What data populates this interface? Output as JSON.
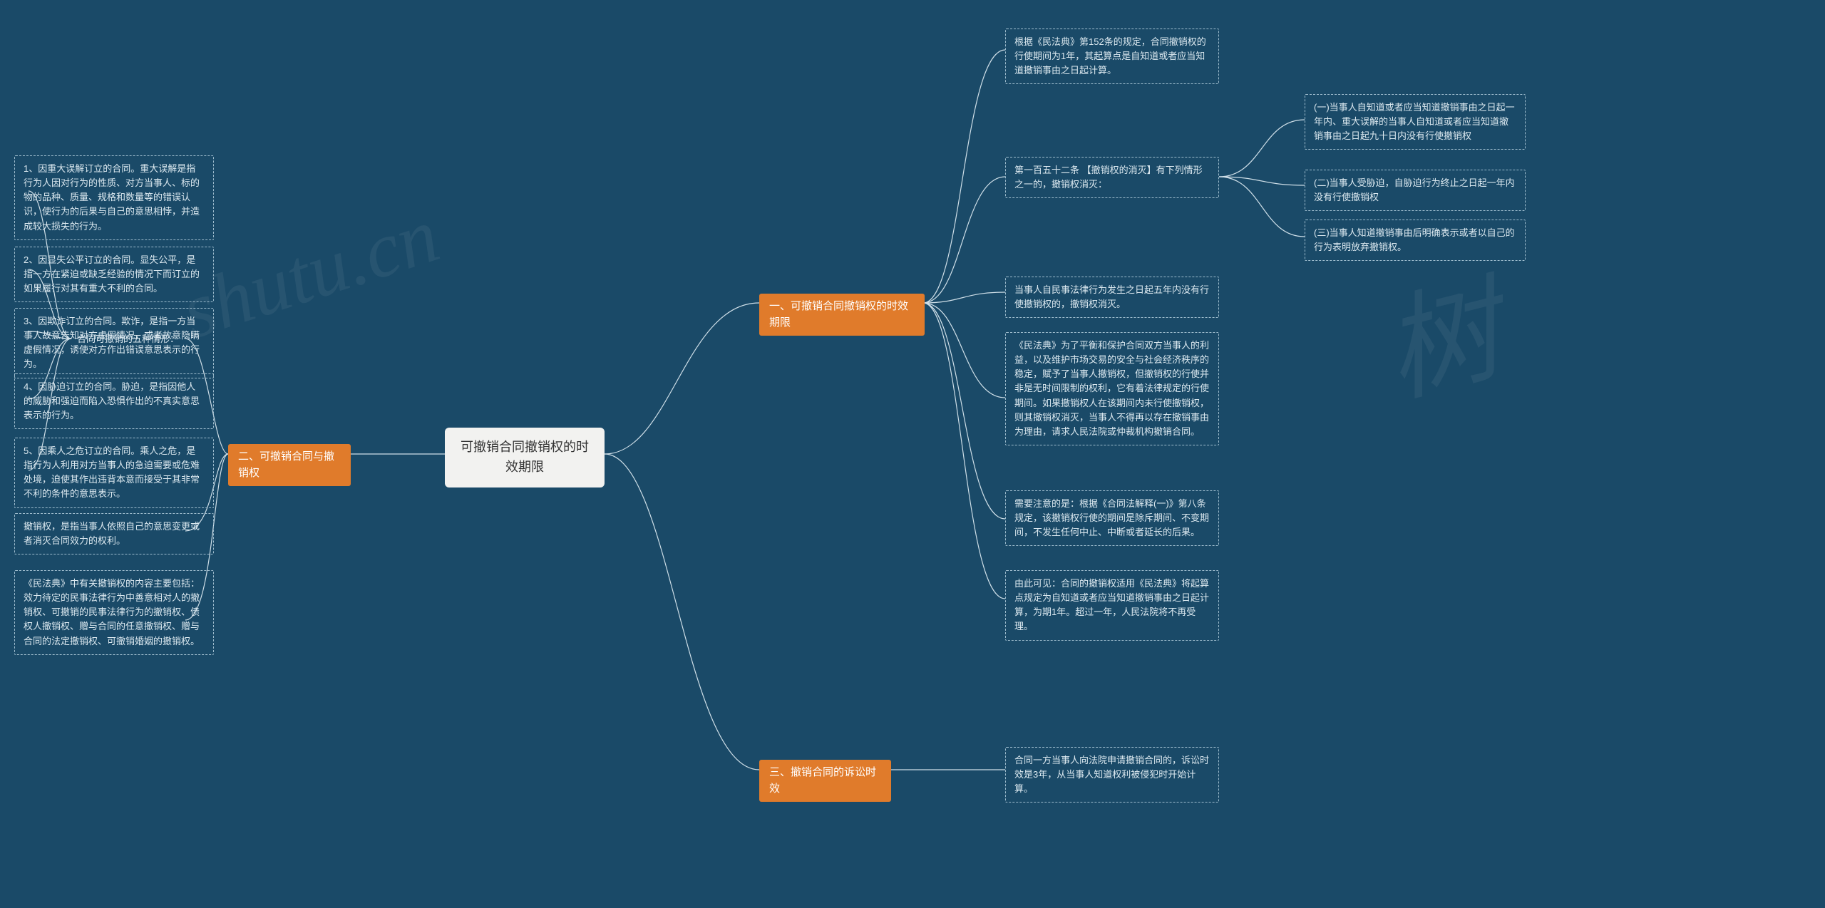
{
  "watermark_left": "shutu.cn",
  "watermark_right": "树",
  "root": {
    "title": "可撤销合同撤销权的时效期限"
  },
  "branches": {
    "s1": {
      "label": "一、可撤销合同撤销权的时效期限",
      "items": {
        "a": "根据《民法典》第152条的规定，合同撤销权的行使期间为1年，其起算点是自知道或者应当知道撤销事由之日起计算。",
        "b": {
          "label": "第一百五十二条 【撤销权的消灭】有下列情形之一的，撤销权消灭：",
          "subs": {
            "i": "(一)当事人自知道或者应当知道撤销事由之日起一年内、重大误解的当事人自知道或者应当知道撤销事由之日起九十日内没有行使撤销权",
            "ii": "(二)当事人受胁迫，自胁迫行为终止之日起一年内没有行使撤销权",
            "iii": "(三)当事人知道撤销事由后明确表示或者以自己的行为表明放弃撤销权。"
          }
        },
        "c": "当事人自民事法律行为发生之日起五年内没有行使撤销权的，撤销权消灭。",
        "d": "《民法典》为了平衡和保护合同双方当事人的利益，以及维护市场交易的安全与社会经济秩序的稳定，赋予了当事人撤销权，但撤销权的行使并非是无时间限制的权利，它有着法律规定的行使期间。如果撤销权人在该期间内未行使撤销权，则其撤销权消灭，当事人不得再以存在撤销事由为理由，请求人民法院或仲裁机构撤销合同。",
        "e": "需要注意的是：根据《合同法解释(一)》第八条规定，该撤销权行使的期间是除斥期间、不变期间，不发生任何中止、中断或者延长的后果。",
        "f": "由此可见：合同的撤销权适用《民法典》将起算点规定为自知道或者应当知道撤销事由之日起计算，为期1年。超过一年，人民法院将不再受理。"
      }
    },
    "s2": {
      "label": "二、可撤销合同与撤销权",
      "intro": "合同可撤销的五种情形：",
      "items": {
        "a": "1、因重大误解订立的合同。重大误解是指行为人因对行为的性质、对方当事人、标的物的品种、质量、规格和数量等的错误认识，使行为的后果与自己的意思相悖，并造成较大损失的行为。",
        "b": "2、因显失公平订立的合同。显失公平，是指一方在紧迫或缺乏经验的情况下而订立的如果履行对其有重大不利的合同。",
        "c": "3、因欺诈订立的合同。欺诈，是指一方当事人故意告知对方虚假情况，或者故意隐瞒虚假情况，诱使对方作出错误意思表示的行为。",
        "d": "4、因胁迫订立的合同。胁迫，是指因他人的威胁和强迫而陷入恐惧作出的不真实意思表示的行为。",
        "e": "5、因乘人之危订立的合同。乘人之危，是指行为人利用对方当事人的急迫需要或危难处境，迫使其作出违背本意而接受于其非常不利的条件的意思表示。"
      },
      "extras": {
        "g": "撤销权，是指当事人依照自己的意思变更或者消灭合同效力的权利。",
        "h": "《民法典》中有关撤销权的内容主要包括：效力待定的民事法律行为中善意相对人的撤销权、可撤销的民事法律行为的撤销权、债权人撤销权、赠与合同的任意撤销权、赠与合同的法定撤销权、可撤销婚姻的撤销权。"
      }
    },
    "s3": {
      "label": "三、撤销合同的诉讼时效",
      "items": {
        "a": "合同一方当事人向法院申请撤销合同的，诉讼时效是3年，从当事人知道权利被侵犯时开始计算。"
      }
    }
  }
}
